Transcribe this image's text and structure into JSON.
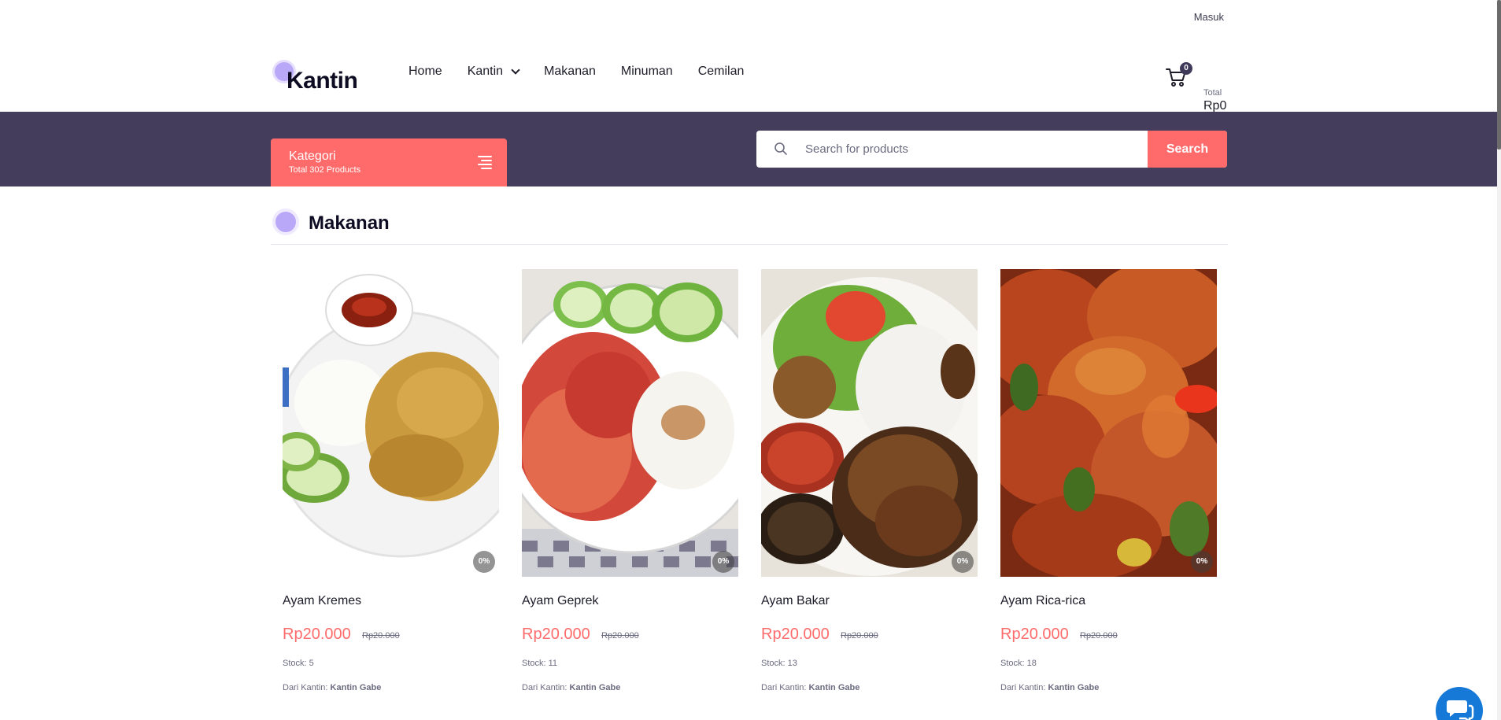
{
  "topbar": {
    "login_label": "Masuk"
  },
  "brand": {
    "name": "Kantin"
  },
  "nav": {
    "items": [
      {
        "label": "Home"
      },
      {
        "label": "Kantin"
      },
      {
        "label": "Makanan"
      },
      {
        "label": "Minuman"
      },
      {
        "label": "Cemilan"
      }
    ]
  },
  "cart": {
    "count": "0",
    "total_label": "Total",
    "total_value": "Rp0"
  },
  "category": {
    "title": "Kategori",
    "subtitle": "Total 302 Products"
  },
  "search": {
    "placeholder": "Search for products",
    "button_label": "Search"
  },
  "section": {
    "title": "Makanan"
  },
  "products": [
    {
      "name": "Ayam Kremes",
      "price": "Rp20.000",
      "old_price": "Rp20.000",
      "discount": "0%",
      "stock": "Stock: 5",
      "seller_prefix": "Dari Kantin:",
      "seller": "Kantin Gabe"
    },
    {
      "name": "Ayam Geprek",
      "price": "Rp20.000",
      "old_price": "Rp20.000",
      "discount": "0%",
      "stock": "Stock: 11",
      "seller_prefix": "Dari Kantin:",
      "seller": "Kantin Gabe"
    },
    {
      "name": "Ayam Bakar",
      "price": "Rp20.000",
      "old_price": "Rp20.000",
      "discount": "0%",
      "stock": "Stock: 13",
      "seller_prefix": "Dari Kantin:",
      "seller": "Kantin Gabe"
    },
    {
      "name": "Ayam Rica-rica",
      "price": "Rp20.000",
      "old_price": "Rp20.000",
      "discount": "0%",
      "stock": "Stock: 18",
      "seller_prefix": "Dari Kantin:",
      "seller": "Kantin Gabe"
    }
  ],
  "colors": {
    "accent": "#ff6b6b",
    "band": "#443d5c",
    "brand_dot": "#b9a8f7",
    "chat": "#1679d8"
  }
}
